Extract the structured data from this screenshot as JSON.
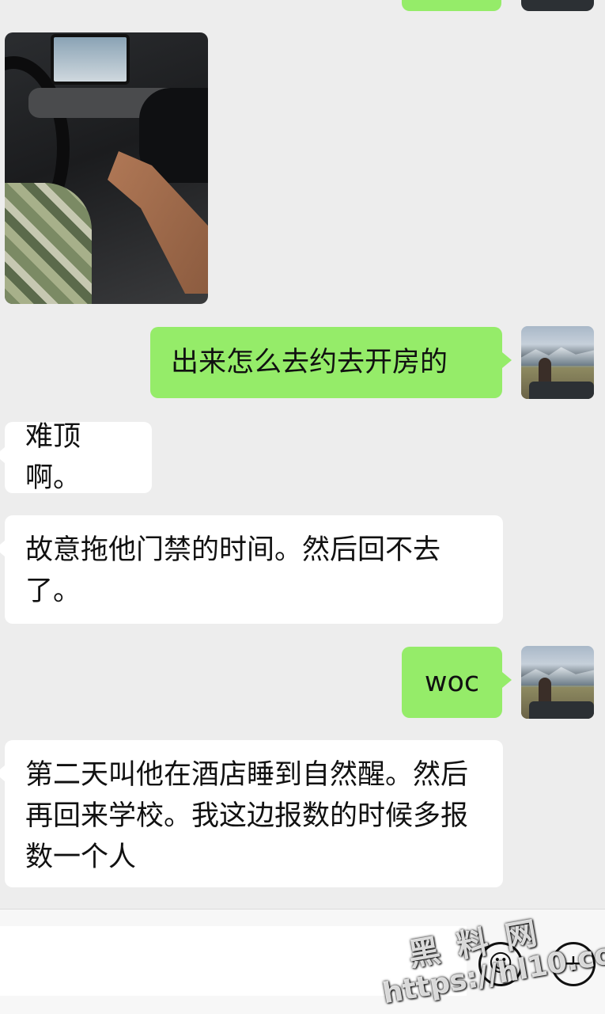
{
  "messages": [
    {
      "text": "出来怎么去约去开房的"
    },
    {
      "text": "难顶啊。"
    },
    {
      "text": "故意拖他门禁的时间。然后回不去了。"
    },
    {
      "text": "woc"
    },
    {
      "text": "第二天叫他在酒店睡到自然醒。然后再回来学校。我这边报数的时候多报数一个人"
    }
  ],
  "input": {
    "emoji_icon": "☺",
    "plus_icon": "+"
  },
  "watermark": {
    "brand": "黑 料 网",
    "url": "https://hl10.co"
  },
  "colors": {
    "outgoing_bubble": "#95ec69",
    "incoming_bubble": "#ffffff",
    "chat_background": "#ededed"
  }
}
